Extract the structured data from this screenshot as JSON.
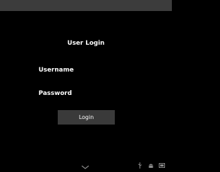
{
  "login": {
    "title": "User Login",
    "username_label": "Username",
    "username_value": "",
    "password_label": "Password",
    "password_value": "",
    "button_label": "Login"
  },
  "navigation": {
    "icons": [
      "chevron-down-icon",
      "usb-icon",
      "android-icon",
      "phone-icon"
    ]
  },
  "colors": {
    "background": "#000000",
    "status_bar": "#3c3c3c",
    "button": "#3a3a3a",
    "text": "#ffffff"
  }
}
